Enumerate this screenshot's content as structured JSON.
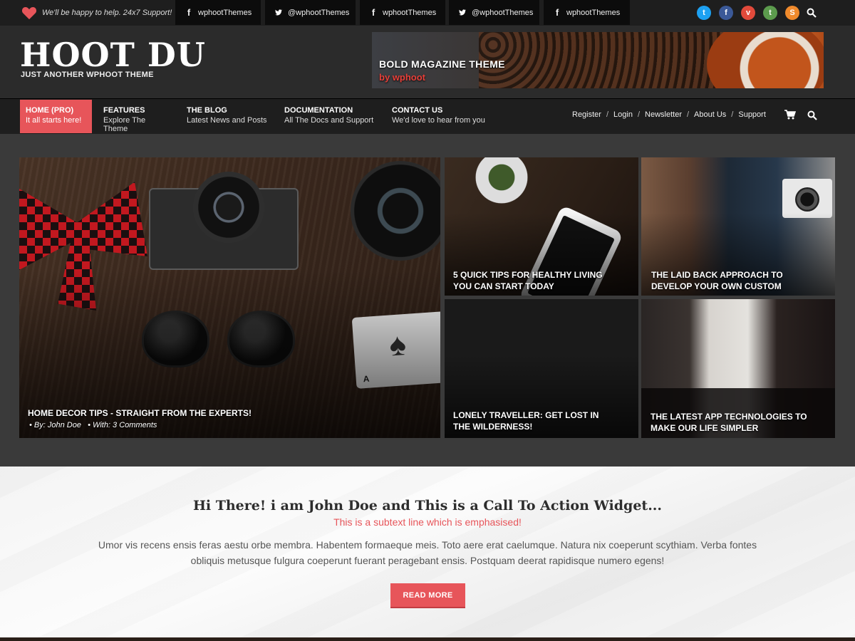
{
  "topbar": {
    "support_text": "We'll be happy to help. 24x7 Support!",
    "social_links": [
      {
        "icon": "facebook-icon",
        "glyph": "f",
        "label": "wphootThemes"
      },
      {
        "icon": "twitter-icon",
        "glyph": "t",
        "label": "@wphootThemes"
      },
      {
        "icon": "facebook-icon",
        "glyph": "f",
        "label": "wphootThemes"
      },
      {
        "icon": "twitter-icon",
        "glyph": "t",
        "label": "@wphootThemes"
      },
      {
        "icon": "facebook-icon",
        "glyph": "f",
        "label": "wphootThemes"
      }
    ],
    "social_icons": [
      {
        "name": "twitter-icon",
        "glyph": "t",
        "color": "#1da1f2"
      },
      {
        "name": "facebook-icon",
        "glyph": "f",
        "color": "#3b5998"
      },
      {
        "name": "vimeo-icon",
        "glyph": "v",
        "color": "#e24a3b"
      },
      {
        "name": "tumblr-icon",
        "glyph": "t",
        "color": "#5c9b4d"
      },
      {
        "name": "skype-icon",
        "glyph": "S",
        "color": "#f08a2c"
      }
    ]
  },
  "header": {
    "site_title": "HOOT DU",
    "tagline": "JUST ANOTHER WPHOOT THEME",
    "banner_title": "BOLD MAGAZINE THEME",
    "banner_sub": "by wphoot"
  },
  "nav": {
    "items": [
      {
        "title": "HOME (PRO)",
        "desc": "It all starts here!"
      },
      {
        "title": "FEATURES",
        "desc": "Explore The Theme"
      },
      {
        "title": "THE BLOG",
        "desc": "Latest News and Posts"
      },
      {
        "title": "DOCUMENTATION",
        "desc": "All The Docs and Support"
      },
      {
        "title": "CONTACT US",
        "desc": "We'd love to hear from you"
      }
    ],
    "secondary": [
      "Register",
      "Login",
      "Newsletter",
      "About Us",
      "Support"
    ],
    "separator": "/"
  },
  "featured": {
    "main": {
      "title": "HOME DECOR TIPS - STRAIGHT FROM THE EXPERTS!",
      "author": "• By: John Doe",
      "comments": "• With: 3 Comments"
    },
    "tiles": [
      {
        "title": "5 QUICK TIPS FOR HEALTHY LIVING YOU CAN START TODAY"
      },
      {
        "title": "THE LAID BACK APPROACH TO DEVELOP YOUR OWN CUSTOM"
      },
      {
        "title": "LONELY TRAVELLER: GET LOST IN THE WILDERNESS!"
      },
      {
        "title": "THE LATEST APP TECHNOLOGIES TO MAKE OUR LIFE SIMPLER"
      }
    ],
    "card_rank": "A"
  },
  "cta": {
    "title": "Hi There! i am John Doe and This is a Call To Action Widget...",
    "subtitle": "This is a subtext line which is emphasised!",
    "text": "Umor vis recens ensis feras aestu orbe membra. Habentem formaeque meis. Toto aere erat caelumque. Natura nix coeperunt scythiam. Verba fontes obliquis metusque fulgura coeperunt fuerant peragebant ensis. Postquam deerat rapidisque numero egens!",
    "button": "READ MORE"
  },
  "colors": {
    "accent": "#e7555a",
    "topbar": "#1e1e1e",
    "header": "#2b2b2b"
  }
}
